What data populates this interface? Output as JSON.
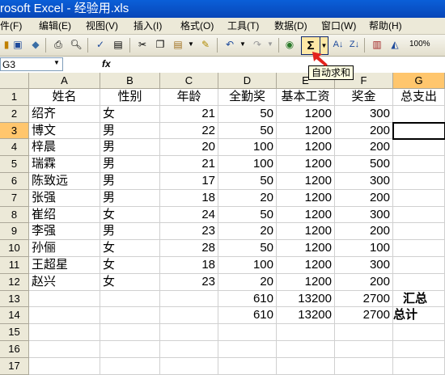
{
  "title": "rosoft Excel - 经验用.xls",
  "menu": [
    "件(F)",
    "编辑(E)",
    "视图(V)",
    "插入(I)",
    "格式(O)",
    "工具(T)",
    "数据(D)",
    "窗口(W)",
    "帮助(H)"
  ],
  "toolbar": {
    "sigma": "Σ",
    "zoom": "100%",
    "tooltip": "自动求和"
  },
  "formula_bar": {
    "name_box": "G3",
    "fx": "fx",
    "content": ""
  },
  "column_headers": [
    "A",
    "B",
    "C",
    "D",
    "E",
    "F",
    "G"
  ],
  "header_row": [
    "姓名",
    "性别",
    "年龄",
    "全勤奖",
    "基本工资",
    "奖金",
    "总支出"
  ],
  "rows": [
    [
      "绍齐",
      "女",
      "21",
      "50",
      "1200",
      "300",
      ""
    ],
    [
      "博文",
      "男",
      "22",
      "50",
      "1200",
      "200",
      ""
    ],
    [
      "梓晨",
      "男",
      "20",
      "100",
      "1200",
      "200",
      ""
    ],
    [
      "瑞霖",
      "男",
      "21",
      "100",
      "1200",
      "500",
      ""
    ],
    [
      "陈致远",
      "男",
      "17",
      "50",
      "1200",
      "300",
      ""
    ],
    [
      "张强",
      "男",
      "18",
      "20",
      "1200",
      "200",
      ""
    ],
    [
      "崔绍",
      "女",
      "24",
      "50",
      "1200",
      "300",
      ""
    ],
    [
      "李强",
      "男",
      "23",
      "20",
      "1200",
      "200",
      ""
    ],
    [
      "孙俪",
      "女",
      "28",
      "50",
      "1200",
      "100",
      ""
    ],
    [
      "王超星",
      "女",
      "18",
      "100",
      "1200",
      "300",
      ""
    ],
    [
      "赵兴",
      "女",
      "23",
      "20",
      "1200",
      "200",
      ""
    ],
    [
      "",
      "",
      "",
      "610",
      "13200",
      "2700",
      "汇总"
    ],
    [
      "",
      "",
      "",
      "610",
      "13200",
      "2700",
      "总计"
    ],
    [
      "",
      "",
      "",
      "",
      "",
      "",
      ""
    ],
    [
      "",
      "",
      "",
      "",
      "",
      "",
      ""
    ],
    [
      "",
      "",
      "",
      "",
      "",
      "",
      ""
    ]
  ],
  "row_numbers": [
    "1",
    "2",
    "3",
    "4",
    "5",
    "6",
    "7",
    "8",
    "9",
    "10",
    "11",
    "12",
    "13",
    "14",
    "15",
    "16",
    "17"
  ],
  "selected_cell": "G3"
}
